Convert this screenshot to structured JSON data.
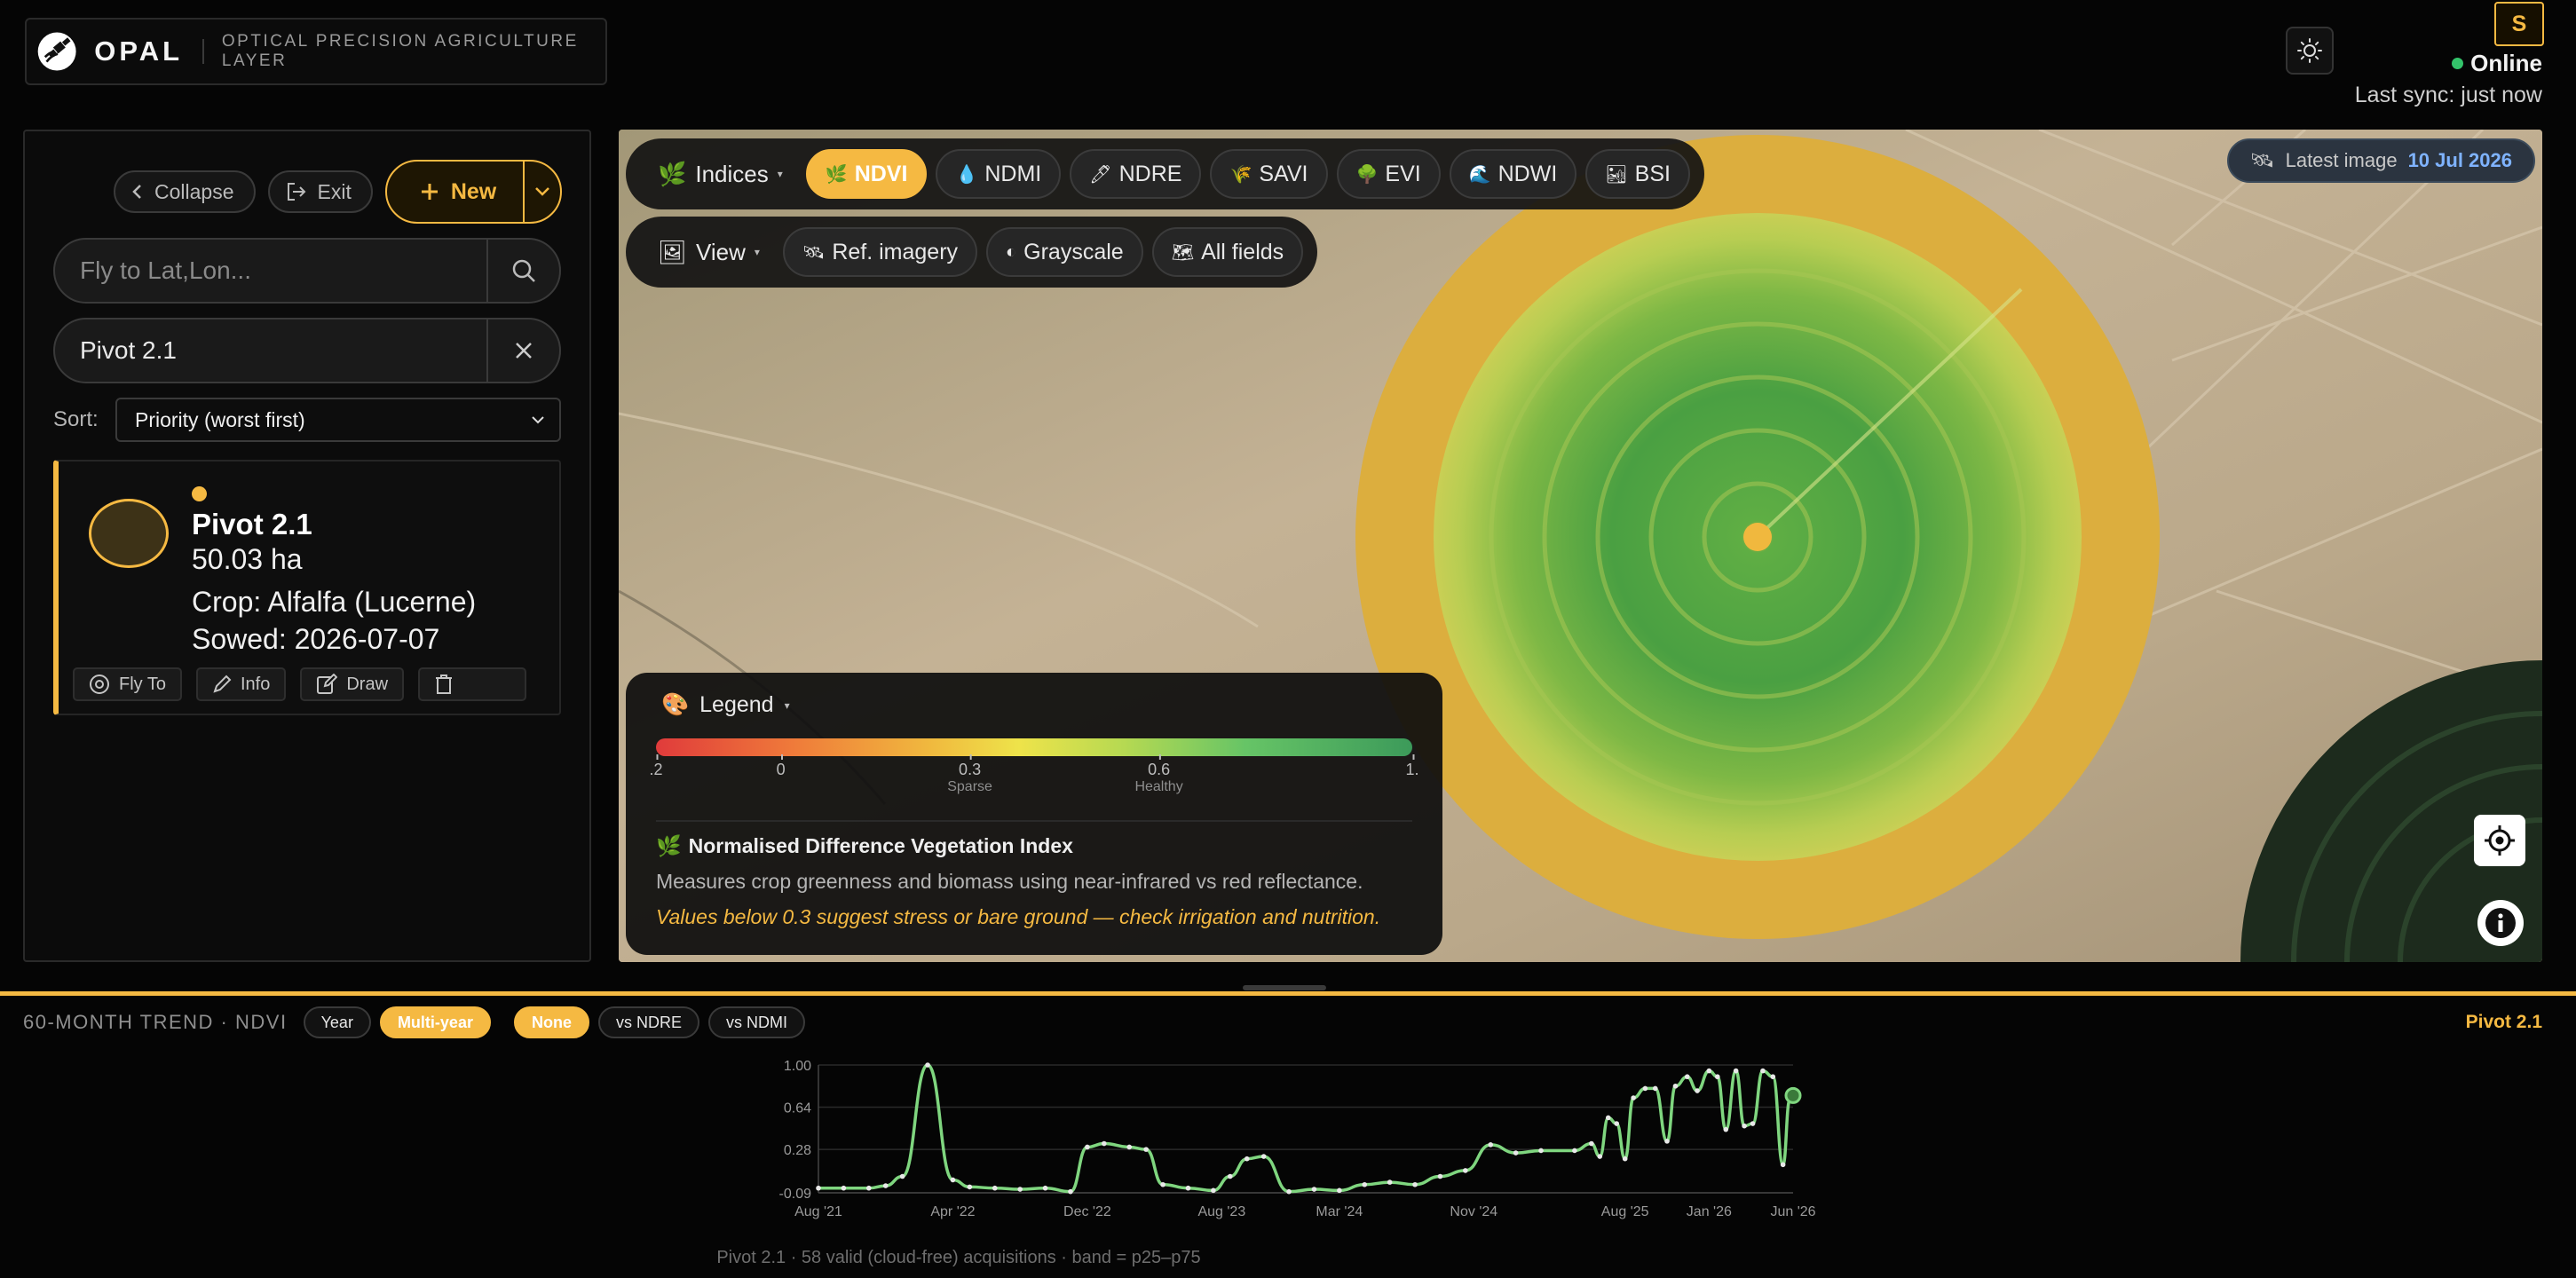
{
  "brand": {
    "name": "OPAL",
    "tagline": "OPTICAL PRECISION AGRICULTURE LAYER"
  },
  "header": {
    "avatar_initial": "S",
    "status": "Online",
    "last_sync": "Last sync: just now",
    "colors": {
      "accent": "#f5b942",
      "online": "#33c36a"
    }
  },
  "sidebar": {
    "collapse_label": "Collapse",
    "exit_label": "Exit",
    "new_label": "New",
    "search_placeholder": "Fly to Lat,Lon...",
    "filter_value": "Pivot 2.1",
    "sort_label": "Sort:",
    "sort_value": "Priority (worst first)",
    "fields": [
      {
        "name": "Pivot 2.1",
        "area": "50.03 ha",
        "crop": "Crop: Alfalfa (Lucerne)",
        "sowed": "Sowed: 2026-07-07",
        "actions": {
          "fly_to": "Fly To",
          "info": "Info",
          "draw": "Draw"
        }
      }
    ]
  },
  "map": {
    "indices_label": "Indices",
    "indices": [
      {
        "label": "NDVI",
        "icon": "🌿",
        "active": true
      },
      {
        "label": "NDMI",
        "icon": "💧",
        "active": false
      },
      {
        "label": "NDRE",
        "icon": "🖊",
        "active": false
      },
      {
        "label": "SAVI",
        "icon": "🌾",
        "active": false
      },
      {
        "label": "EVI",
        "icon": "🌳",
        "active": false
      },
      {
        "label": "NDWI",
        "icon": "🌊",
        "active": false
      },
      {
        "label": "BSI",
        "icon": "🏜",
        "active": false
      }
    ],
    "view_label": "View",
    "view_options": [
      {
        "label": "Ref. imagery",
        "icon": "🛰"
      },
      {
        "label": "Grayscale",
        "icon": "◐"
      },
      {
        "label": "All fields",
        "icon": "🗺"
      }
    ],
    "latest_label": "Latest image",
    "latest_date": "10 Jul 2026",
    "legend": {
      "title": "Legend",
      "ticks": [
        {
          "label": ".2",
          "sub": "",
          "pos": 0.0
        },
        {
          "label": "0",
          "sub": "",
          "pos": 0.165
        },
        {
          "label": "0.3",
          "sub": "Sparse",
          "pos": 0.415
        },
        {
          "label": "0.6",
          "sub": "Healthy",
          "pos": 0.665
        },
        {
          "label": "1.",
          "sub": "",
          "pos": 1.0
        }
      ],
      "index_name": "Normalised Difference Vegetation Index",
      "description": "Measures crop greenness and biomass using near-infrared vs red reflectance.",
      "warning": "Values below 0.3 suggest stress or bare ground — check irrigation and nutrition."
    }
  },
  "trend": {
    "title": "60-MONTH TREND · NDVI",
    "range_options": [
      {
        "label": "Year",
        "active": false
      },
      {
        "label": "Multi-year",
        "active": true
      }
    ],
    "compare_options": [
      {
        "label": "None",
        "active": true
      },
      {
        "label": "vs NDRE",
        "active": false
      },
      {
        "label": "vs NDMI",
        "active": false
      }
    ],
    "field_name": "Pivot 2.1",
    "footnote": "Pivot 2.1 · 58 valid (cloud-free) acquisitions · band = p25–p75"
  },
  "chart_data": {
    "type": "line",
    "title": "",
    "xlabel": "",
    "ylabel": "",
    "ylim": [
      -0.09,
      1.0
    ],
    "yticks": [
      "1.00",
      "0.64",
      "0.28",
      "-0.09"
    ],
    "ytick_values": [
      1.0,
      0.64,
      0.28,
      -0.09
    ],
    "xticks": [
      "Aug '21",
      "Apr '22",
      "Dec '22",
      "Aug '23",
      "Mar '24",
      "Nov '24",
      "Aug '25",
      "Jan '26",
      "Jun '26"
    ],
    "xtick_values": [
      0,
      8,
      16,
      24,
      31,
      39,
      48,
      53,
      58
    ],
    "x_unit": "months since Aug 2021",
    "xlim": [
      0,
      58
    ],
    "grid": true,
    "series": [
      {
        "name": "NDVI",
        "color": "#7fd67f",
        "points": [
          [
            0,
            -0.05
          ],
          [
            1.5,
            -0.05
          ],
          [
            3,
            -0.05
          ],
          [
            4,
            -0.03
          ],
          [
            5,
            0.05
          ],
          [
            6.5,
            1.0
          ],
          [
            8,
            0.02
          ],
          [
            9,
            -0.04
          ],
          [
            10.5,
            -0.05
          ],
          [
            12,
            -0.06
          ],
          [
            13.5,
            -0.05
          ],
          [
            15,
            -0.08
          ],
          [
            16,
            0.3
          ],
          [
            17,
            0.33
          ],
          [
            18.5,
            0.3
          ],
          [
            19.5,
            0.28
          ],
          [
            20.5,
            -0.02
          ],
          [
            22,
            -0.05
          ],
          [
            23.5,
            -0.07
          ],
          [
            24.5,
            0.05
          ],
          [
            25.5,
            0.2
          ],
          [
            26.5,
            0.22
          ],
          [
            28,
            -0.08
          ],
          [
            29.5,
            -0.06
          ],
          [
            31,
            -0.07
          ],
          [
            32.5,
            -0.02
          ],
          [
            34,
            0.0
          ],
          [
            35.5,
            -0.02
          ],
          [
            37,
            0.05
          ],
          [
            38.5,
            0.1
          ],
          [
            40,
            0.32
          ],
          [
            41.5,
            0.25
          ],
          [
            43,
            0.27
          ],
          [
            45,
            0.27
          ],
          [
            46,
            0.33
          ],
          [
            46.5,
            0.22
          ],
          [
            47,
            0.55
          ],
          [
            47.5,
            0.5
          ],
          [
            48,
            0.2
          ],
          [
            48.5,
            0.72
          ],
          [
            49.2,
            0.8
          ],
          [
            49.8,
            0.8
          ],
          [
            50.5,
            0.35
          ],
          [
            51,
            0.82
          ],
          [
            51.7,
            0.9
          ],
          [
            52.3,
            0.78
          ],
          [
            53,
            0.95
          ],
          [
            53.5,
            0.9
          ],
          [
            54,
            0.45
          ],
          [
            54.6,
            0.95
          ],
          [
            55.1,
            0.48
          ],
          [
            55.6,
            0.5
          ],
          [
            56.2,
            0.95
          ],
          [
            56.8,
            0.9
          ],
          [
            57.4,
            0.15
          ],
          [
            57.8,
            0.7
          ],
          [
            58,
            0.74
          ]
        ]
      }
    ]
  }
}
